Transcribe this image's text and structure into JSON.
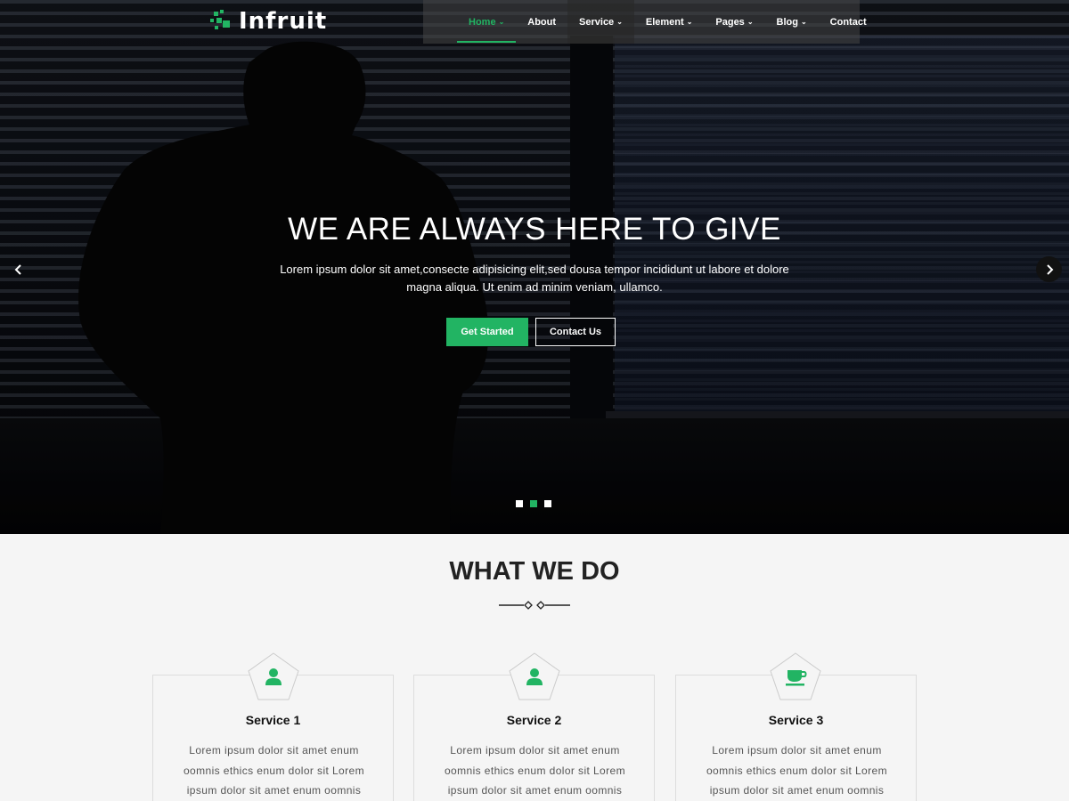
{
  "brand": {
    "name": "Infruit",
    "accent": "#22b463"
  },
  "nav": {
    "items": [
      {
        "label": "Home",
        "has_dropdown": true,
        "active": true
      },
      {
        "label": "About",
        "has_dropdown": false
      },
      {
        "label": "Service",
        "has_dropdown": true
      },
      {
        "label": "Element",
        "has_dropdown": true
      },
      {
        "label": "Pages",
        "has_dropdown": true
      },
      {
        "label": "Blog",
        "has_dropdown": true
      },
      {
        "label": "Contact",
        "has_dropdown": false
      }
    ],
    "caret_icon": "chevron-down-icon"
  },
  "hero": {
    "title": "WE ARE ALWAYS HERE TO GIVE",
    "text": "Lorem ipsum dolor sit amet,consecte adipisicing elit,sed dousa tempor incididunt ut labore et dolore magna aliqua. Ut enim ad minim veniam, ullamco.",
    "primary_button": "Get Started",
    "secondary_button": "Contact Us",
    "prev_icon": "chevron-left-icon",
    "next_icon": "chevron-right-icon",
    "slides_count": 3,
    "active_slide": 2
  },
  "services_section": {
    "title": "WHAT WE DO",
    "cards": [
      {
        "title": "Service 1",
        "icon": "user-icon",
        "text": "Lorem ipsum dolor sit amet enum oomnis ethics enum dolor sit Lorem ipsum dolor sit amet enum oomnis"
      },
      {
        "title": "Service 2",
        "icon": "user-icon",
        "text": "Lorem ipsum dolor sit amet enum oomnis ethics enum dolor sit Lorem ipsum dolor sit amet enum oomnis"
      },
      {
        "title": "Service 3",
        "icon": "coffee-cup-icon",
        "text": "Lorem ipsum dolor sit amet enum oomnis ethics enum dolor sit Lorem ipsum dolor sit amet enum oomnis"
      }
    ]
  }
}
